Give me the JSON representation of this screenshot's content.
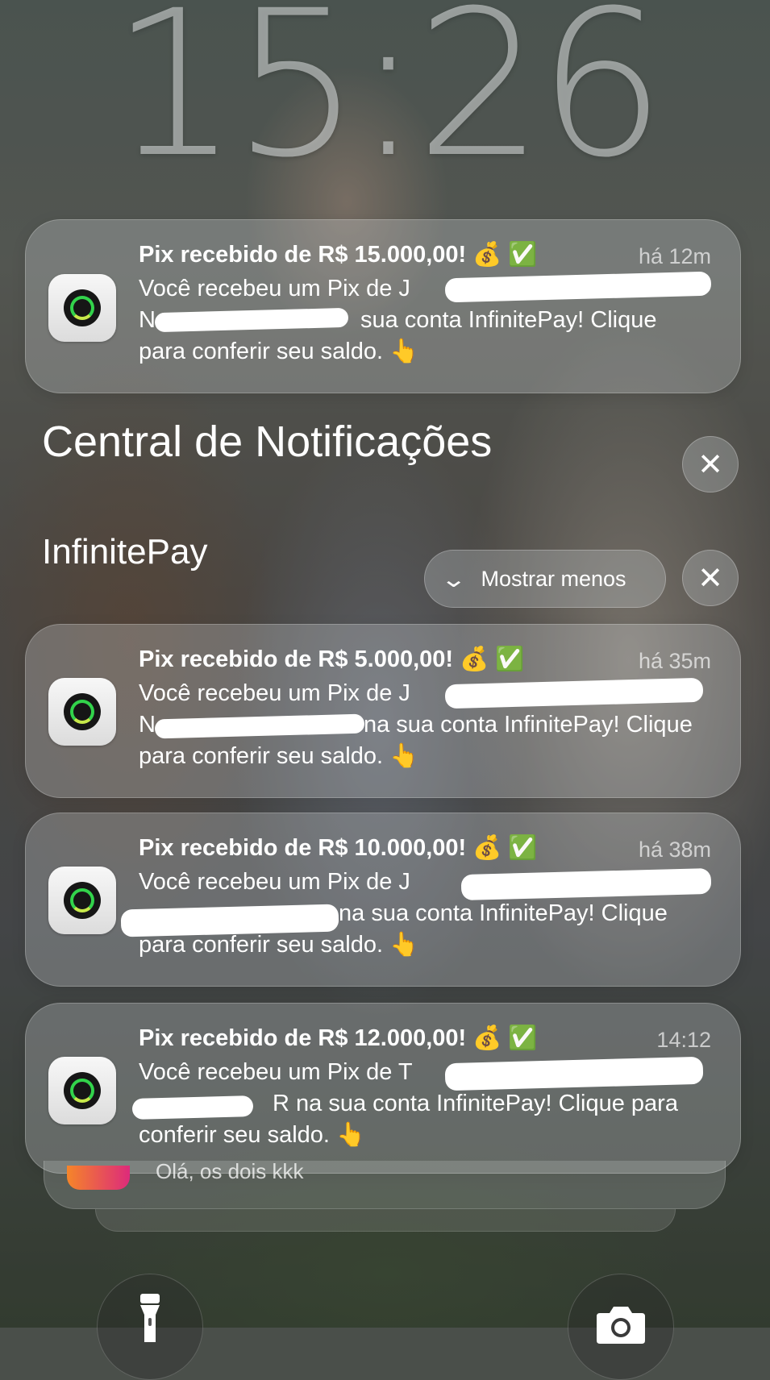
{
  "lock_screen": {
    "time": "15:26"
  },
  "top_notification": {
    "title": "Pix recebido de R$ 15.000,00! 💰 ✅",
    "time": "há 12m",
    "line1": "Você recebeu um Pix de J",
    "line2_prefix": "N",
    "line2_suffix": "sua conta InfinitePay! Clique",
    "line3": "para conferir seu saldo. 👆"
  },
  "notification_center": {
    "title": "Central de Notificações",
    "clear_icon": "close-icon"
  },
  "group": {
    "name": "InfinitePay",
    "show_less_label": "Mostrar menos",
    "chevron_icon": "chevron-down-icon",
    "clear_icon": "close-icon"
  },
  "notifications": [
    {
      "title": "Pix recebido de R$ 5.000,00! 💰 ✅",
      "time": "há 35m",
      "line1": "Você recebeu um Pix de J",
      "line2_prefix": "N",
      "line2_suffix": "na sua conta InfinitePay! Clique",
      "line3": "para conferir seu saldo. 👆"
    },
    {
      "title": "Pix recebido de R$ 10.000,00! 💰 ✅",
      "time": "há 38m",
      "line1": "Você recebeu um Pix de J",
      "line2_prefix": "",
      "line2_suffix": "na sua conta InfinitePay! Clique",
      "line3": "para conferir seu saldo. 👆"
    },
    {
      "title": "Pix recebido de R$ 12.000,00! 💰 ✅",
      "time": "14:12",
      "line1": "Você recebeu um Pix de T",
      "line2_prefix": "",
      "line2_suffix": "R na sua conta InfinitePay! Clique para",
      "line3": "conferir seu saldo. 👆"
    }
  ],
  "stacked_preview": {
    "text": "Olá, os dois kkk"
  },
  "bottom_controls": {
    "flashlight_icon": "flashlight-icon",
    "camera_icon": "camera-icon"
  }
}
